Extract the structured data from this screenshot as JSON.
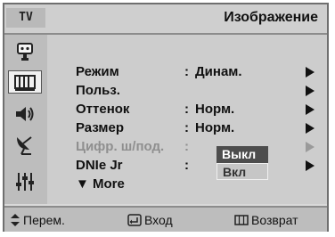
{
  "header": {
    "tv_label": "TV",
    "title": "Изображение"
  },
  "sidebar": {
    "items": [
      {
        "icon": "input-connector-icon",
        "active": false
      },
      {
        "icon": "picture-icon",
        "active": true
      },
      {
        "icon": "sound-icon",
        "active": false
      },
      {
        "icon": "antenna-channel-icon",
        "active": false
      },
      {
        "icon": "setup-sliders-icon",
        "active": false
      }
    ]
  },
  "menu": {
    "items": [
      {
        "label": "Режим",
        "colon": ":",
        "value": "Динам."
      },
      {
        "label": "Польз.",
        "colon": "",
        "value": ""
      },
      {
        "label": "Оттенок",
        "colon": ":",
        "value": "Норм."
      },
      {
        "label": "Размер",
        "colon": ":",
        "value": "Норм."
      },
      {
        "label": "Цифр. ш/под.",
        "colon": ":",
        "value": "",
        "disabled": true
      },
      {
        "label": "DNIe Jr",
        "colon": ":",
        "value": ""
      },
      {
        "label": "▼ More"
      }
    ],
    "dropdown": {
      "options": [
        "Выкл",
        "Вкл"
      ],
      "selected": "Выкл"
    }
  },
  "footer": {
    "move": "Перем.",
    "enter": "Вход",
    "back": "Возврат"
  },
  "colors": {
    "panel": "#d9d9d9",
    "highlight": "#4d4d4d"
  }
}
